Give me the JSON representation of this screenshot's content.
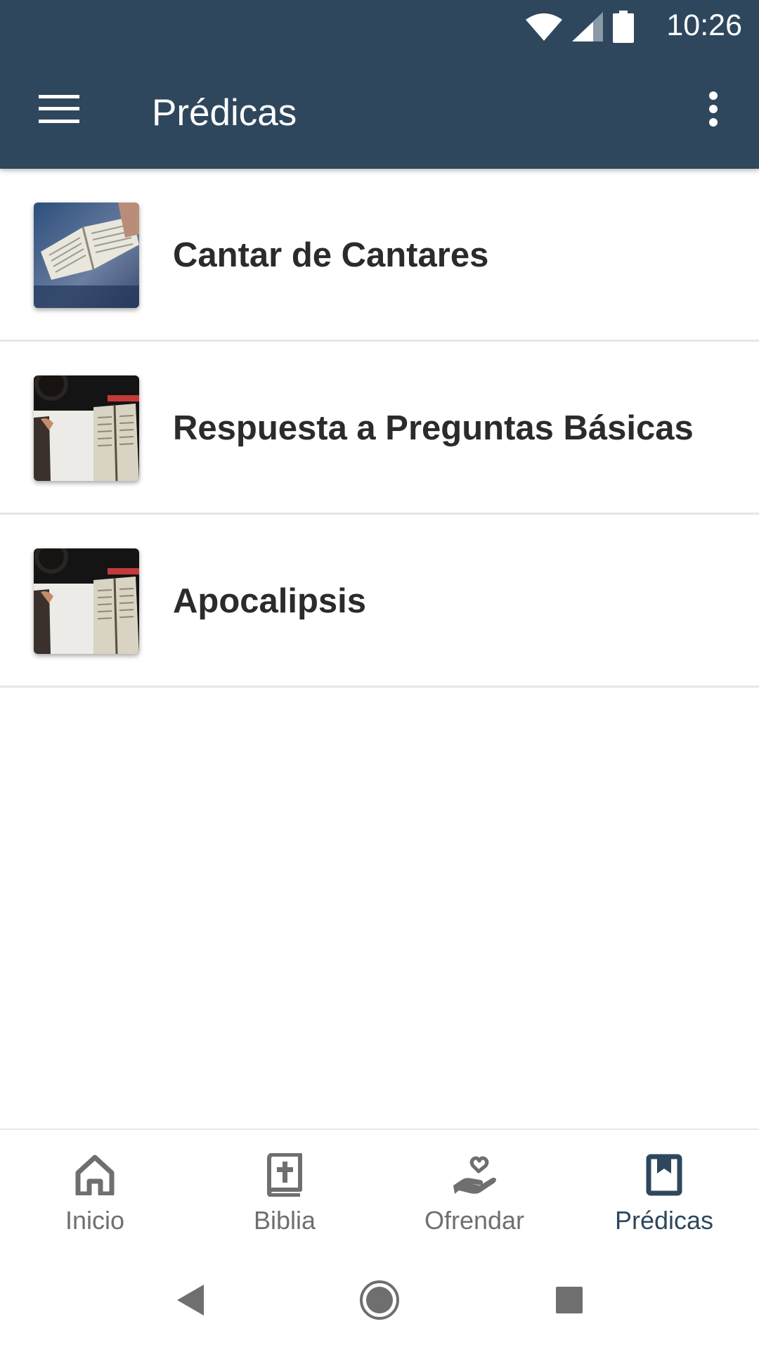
{
  "status_bar": {
    "time": "10:26",
    "icons": [
      "wifi-icon",
      "cell-signal-icon",
      "battery-icon"
    ]
  },
  "app_bar": {
    "title": "Prédicas",
    "menu_icon": "hamburger-menu-icon",
    "overflow_icon": "more-vertical-icon",
    "background_color": "#2e475d"
  },
  "sermons": [
    {
      "title": "Cantar de Cantares",
      "thumbnail": "bible-in-hand-photo"
    },
    {
      "title": "Respuesta a Preguntas Básicas",
      "thumbnail": "desk-bible-notebook-photo"
    },
    {
      "title": "Apocalipsis",
      "thumbnail": "desk-bible-notebook-photo"
    }
  ],
  "bottom_nav": {
    "items": [
      {
        "label": "Inicio",
        "icon": "home-icon",
        "active": false
      },
      {
        "label": "Biblia",
        "icon": "bible-icon",
        "active": false
      },
      {
        "label": "Ofrendar",
        "icon": "donate-hand-heart-icon",
        "active": false
      },
      {
        "label": "Prédicas",
        "icon": "bookmark-book-icon",
        "active": true
      }
    ],
    "active_color": "#2e475d",
    "inactive_color": "#6f6f6f"
  },
  "system_nav": {
    "icons": [
      "back-icon",
      "home-circle-icon",
      "recents-icon"
    ]
  }
}
